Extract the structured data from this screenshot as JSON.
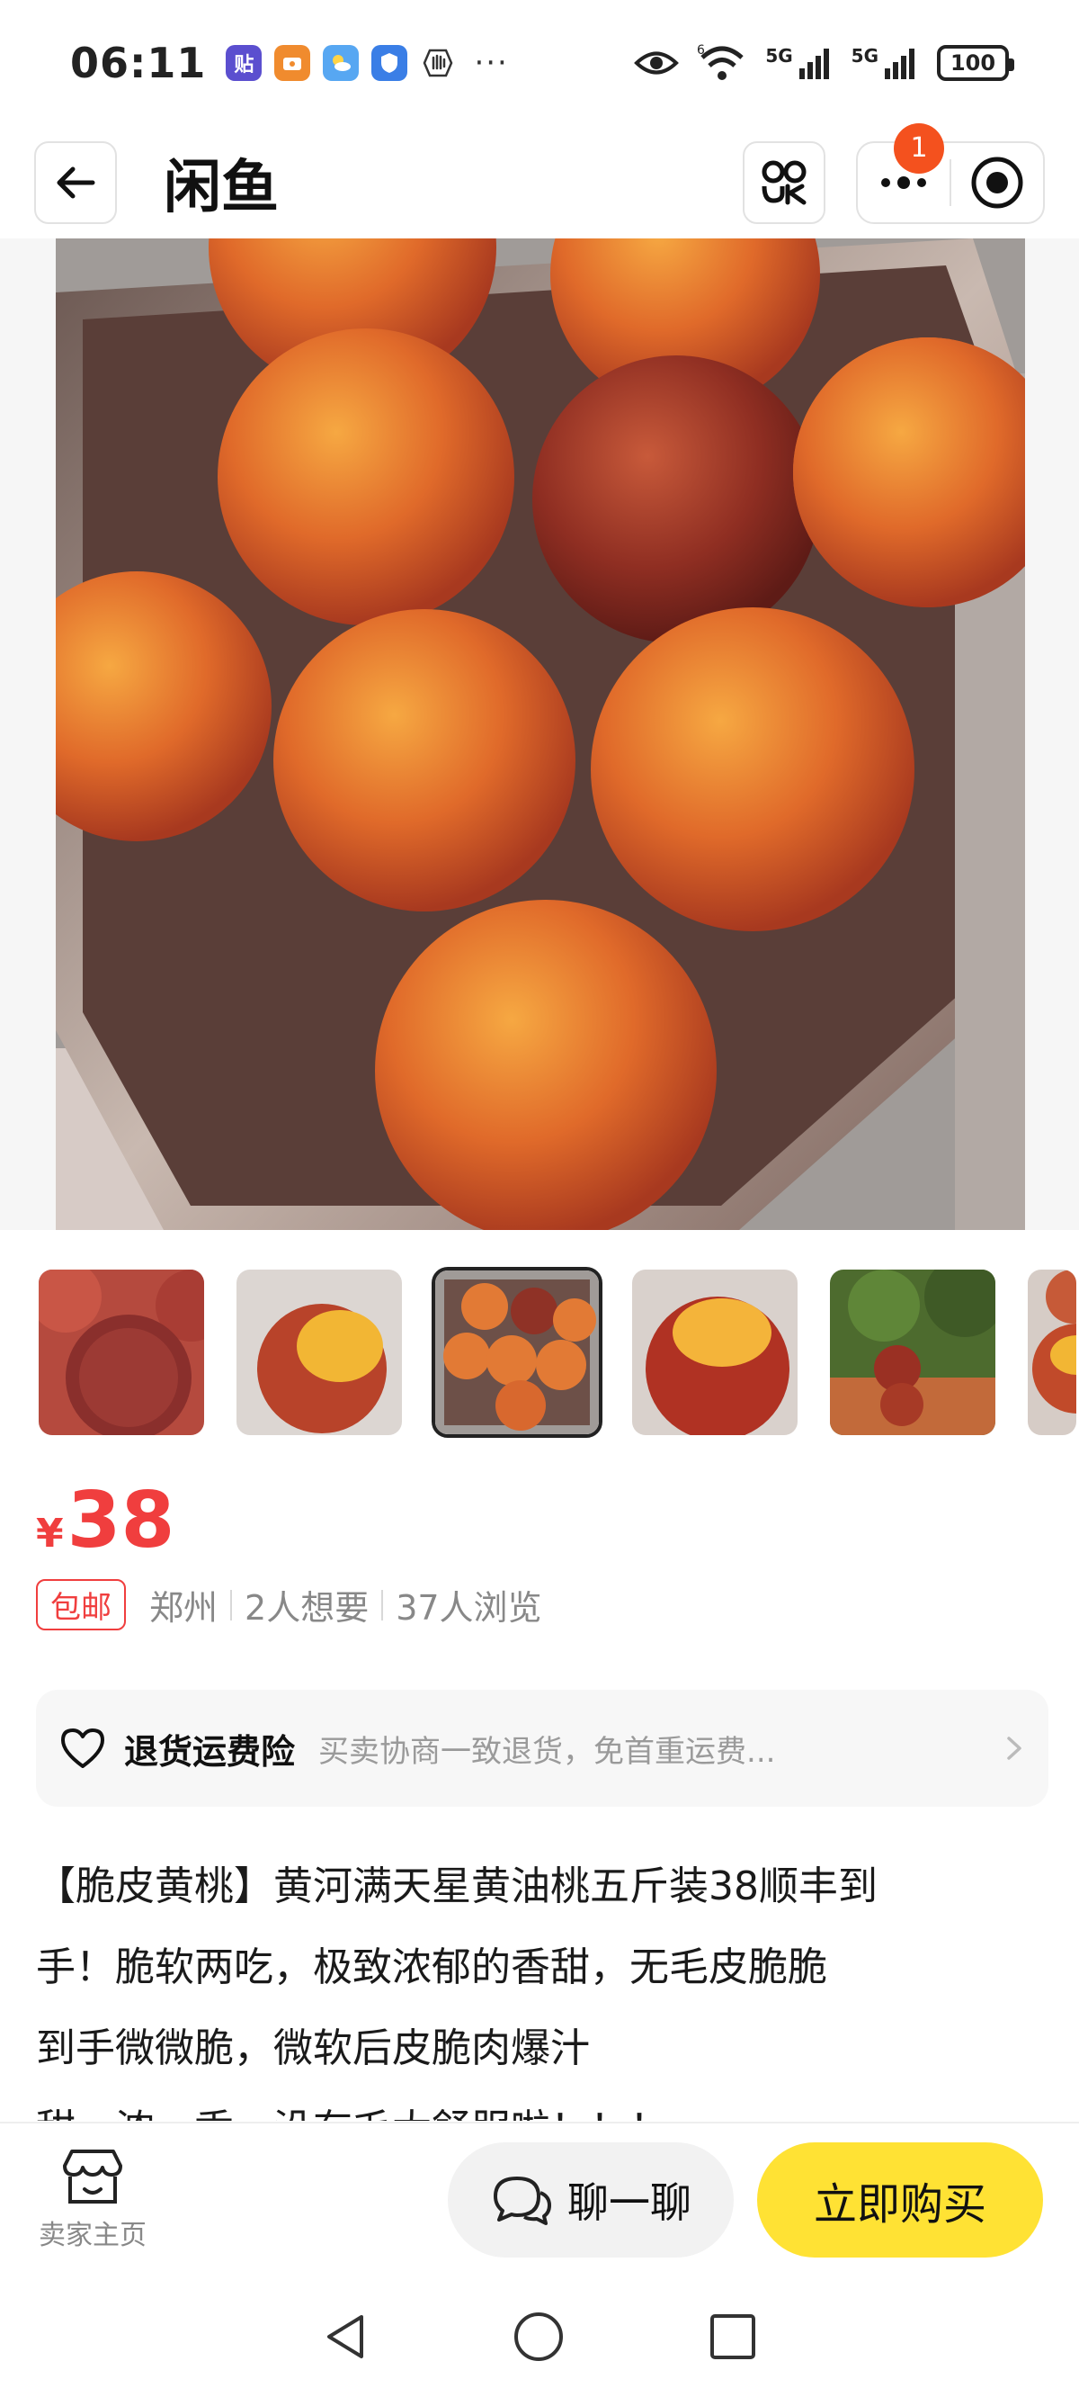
{
  "status_bar": {
    "time": "06:11",
    "notifications": [
      {
        "icon": "tieba-app-icon",
        "glyph": "贴"
      },
      {
        "icon": "reward-app-icon",
        "glyph": ""
      },
      {
        "icon": "weather-app-icon",
        "glyph": ""
      },
      {
        "icon": "security-app-icon",
        "glyph": ""
      },
      {
        "icon": "hand-app-icon",
        "glyph": ""
      }
    ],
    "more": "···",
    "network_1": "5G",
    "network_2": "5G",
    "battery": "100"
  },
  "nav": {
    "title": "闲鱼",
    "badge_count": "1"
  },
  "product": {
    "price_symbol": "¥",
    "price": "38",
    "shipping_tag": "包邮",
    "location": "郑州",
    "wants": "2人想要",
    "views": "37人浏览"
  },
  "insurance": {
    "title": "退货运费险",
    "desc": "买卖协商一致退货，免首重运费..."
  },
  "description": {
    "lines": [
      "【脆皮黄桃】黄河满天星黄油桃五斤装38顺丰到",
      "手！脆软两吃，极致浓郁的香甜，无毛皮脆脆",
      " 到手微微脆，微软后皮脆肉爆汁",
      "甜、浓、香，没有毛太舒服啦！！！"
    ]
  },
  "bottom": {
    "shop_label": "卖家主页",
    "chat_label": "聊一聊",
    "buy_label": "立即购买"
  }
}
